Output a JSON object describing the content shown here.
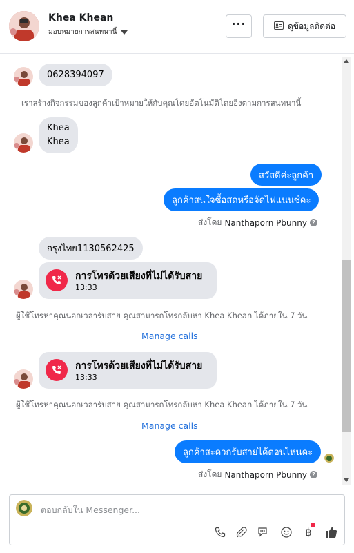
{
  "header": {
    "contact_name": "Khea Khean",
    "assign_label": "มอบหมายการสนทนานี้",
    "more_label": "···",
    "contact_button_label": "ดูข้อมูลติดต่อ"
  },
  "messages": {
    "phone_number": "0628394097",
    "activity_notice": "เราสร้างกิจกรรมของลูกค้าเป้าหมายให้กับคุณโดยอัตโนมัติโดยอิงตามการสนทนานี้",
    "name_line1": "Khea",
    "name_line2": "Khea",
    "out_greeting": "สวัสดีค่ะลูกค้า",
    "out_question": "ลูกค้าสนใจซื้อสดหรือจัดไฟแนนซ์คะ",
    "sent_by_prefix": "ส่งโดย",
    "sent_by_name": "Nanthaporn Pbunny",
    "bank_account": "กรุงไทย1130562425",
    "missed_call_title": "การโทรด้วยเสียงที่ไม่ได้รับสาย",
    "missed_call_time_1": "13:33",
    "missed_call_notice": "ผู้ใช้โทรหาคุณนอกเวลารับสาย คุณสามารถโทรกลับหา Khea Khean ได้ภายใน 7 วัน",
    "manage_calls": "Manage calls",
    "missed_call_time_2": "13:33",
    "out_callback": "ลูกค้าสะดวกรับสายได้ตอนไหนคะ"
  },
  "composer": {
    "placeholder": "ตอบกลับใน Messenger..."
  },
  "icons": {
    "call": "phone-icon",
    "attach": "paperclip-icon",
    "saved_replies": "chat-bubbles-icon",
    "emoji": "emoji-icon",
    "payment": "baht-icon",
    "like": "thumbs-up-icon"
  },
  "colors": {
    "outgoing_bubble": "#0a7cff",
    "incoming_bubble": "#e4e6eb",
    "missed_call_red": "#f02849",
    "link_blue": "#216fdb"
  }
}
